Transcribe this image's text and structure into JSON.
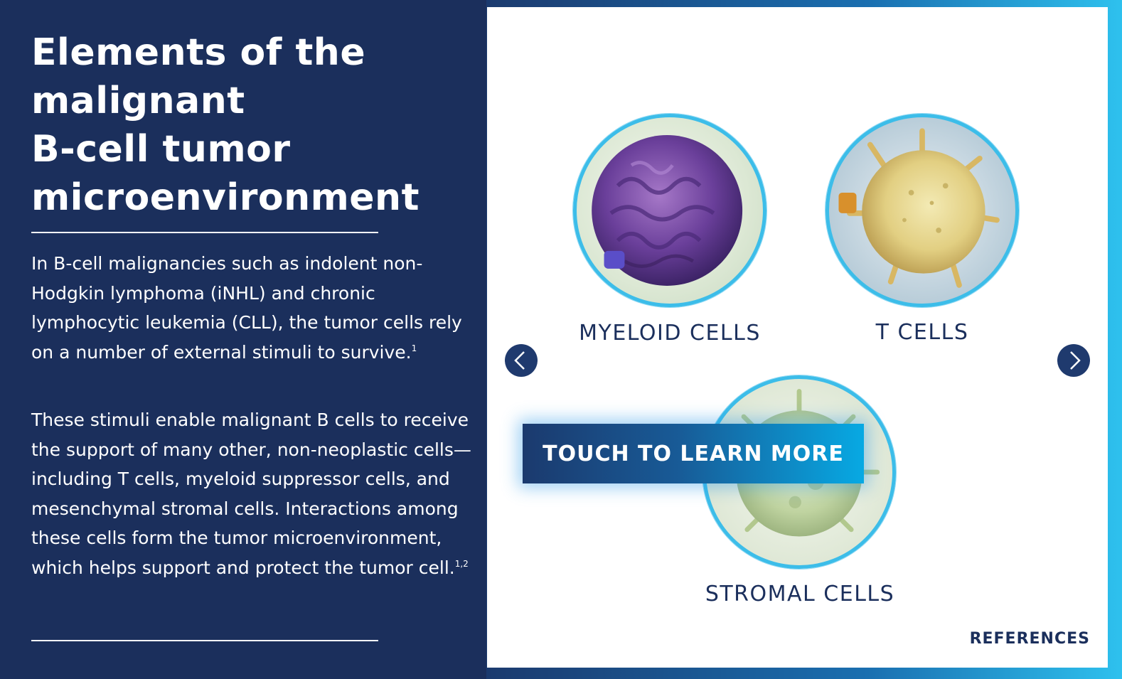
{
  "left": {
    "title_lines": [
      "Elements of the",
      "malignant",
      "B-cell tumor",
      "microenvironment"
    ],
    "paragraph_1": {
      "text": "In B-cell malignancies such as indolent non-Hodgkin lymphoma (iNHL) and chronic lymphocytic leukemia (CLL), the tumor cells rely on a number of external stimuli to survive.",
      "ref": "1"
    },
    "paragraph_2": {
      "text": "These stimuli enable malignant B cells to receive the support of many other, non-neoplastic cells—including T cells, myeloid suppressor cells, and mesenchymal stromal cells. Interactions among these cells form the tumor microenvironment, which helps support and protect the tumor cell.",
      "ref": "1,2"
    }
  },
  "cells": [
    {
      "label": "MYELOID CELLS",
      "image": "purple-myeloid-cell"
    },
    {
      "label": "T CELLS",
      "image": "yellow-t-cell"
    },
    {
      "label": "STROMAL CELLS",
      "image": "green-stromal-cell"
    }
  ],
  "navigation": {
    "prev_icon": "chevron-left-icon",
    "next_icon": "chevron-right-icon"
  },
  "cta": {
    "label": "TOUCH TO LEARN MORE"
  },
  "footer": {
    "references_label": "REFERENCES"
  },
  "colors": {
    "navy": "#1b2f5c",
    "accent_cyan": "#3cbde9",
    "cta_bright": "#07a9e3",
    "white": "#ffffff"
  }
}
